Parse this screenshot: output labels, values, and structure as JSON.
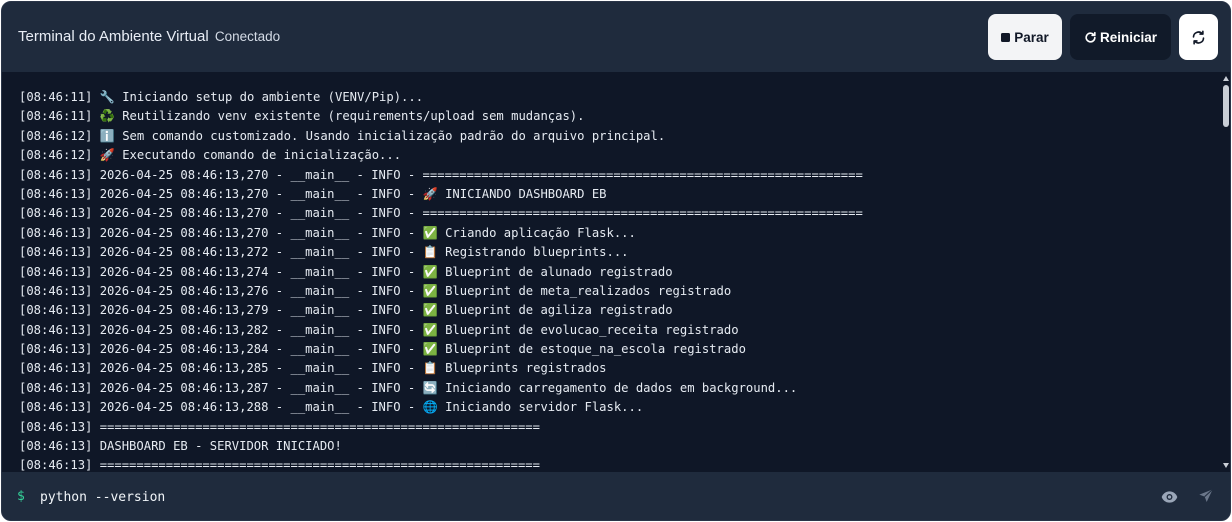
{
  "header": {
    "title": "Terminal do Ambiente Virtual",
    "status": "Conectado",
    "buttons": {
      "stop": "Parar",
      "restart": "Reiniciar"
    }
  },
  "icons": [
    "stop-square-icon",
    "restart-icon",
    "sync-icon",
    "eye-icon",
    "send-icon"
  ],
  "colors": {
    "background": "#1f2a3c",
    "terminal": "#0f1727",
    "prompt": "#34d399"
  },
  "log_lines": [
    "[08:46:11] 🔧 Iniciando setup do ambiente (VENV/Pip)...",
    "[08:46:11] ♻️ Reutilizando venv existente (requirements/upload sem mudanças).",
    "[08:46:12] ℹ️ Sem comando customizado. Usando inicialização padrão do arquivo principal.",
    "[08:46:12] 🚀 Executando comando de inicialização...",
    "[08:46:13] 2026-04-25 08:46:13,270 - __main__ - INFO - ============================================================",
    "[08:46:13] 2026-04-25 08:46:13,270 - __main__ - INFO - 🚀 INICIANDO DASHBOARD EB",
    "[08:46:13] 2026-04-25 08:46:13,270 - __main__ - INFO - ============================================================",
    "[08:46:13] 2026-04-25 08:46:13,270 - __main__ - INFO - ✅ Criando aplicação Flask...",
    "[08:46:13] 2026-04-25 08:46:13,272 - __main__ - INFO - 📋 Registrando blueprints...",
    "[08:46:13] 2026-04-25 08:46:13,274 - __main__ - INFO - ✅ Blueprint de alunado registrado",
    "[08:46:13] 2026-04-25 08:46:13,276 - __main__ - INFO - ✅ Blueprint de meta_realizados registrado",
    "[08:46:13] 2026-04-25 08:46:13,279 - __main__ - INFO - ✅ Blueprint de agiliza registrado",
    "[08:46:13] 2026-04-25 08:46:13,282 - __main__ - INFO - ✅ Blueprint de evolucao_receita registrado",
    "[08:46:13] 2026-04-25 08:46:13,284 - __main__ - INFO - ✅ Blueprint de estoque_na_escola registrado",
    "[08:46:13] 2026-04-25 08:46:13,285 - __main__ - INFO - 📋 Blueprints registrados",
    "[08:46:13] 2026-04-25 08:46:13,287 - __main__ - INFO - 🔄 Iniciando carregamento de dados em background...",
    "[08:46:13] 2026-04-25 08:46:13,288 - __main__ - INFO - 🌐 Iniciando servidor Flask...",
    "[08:46:13] ============================================================",
    "[08:46:13] DASHBOARD EB - SERVIDOR INICIADO!",
    "[08:46:13] ============================================================"
  ],
  "input": {
    "prompt": "$",
    "value": "python --version"
  }
}
